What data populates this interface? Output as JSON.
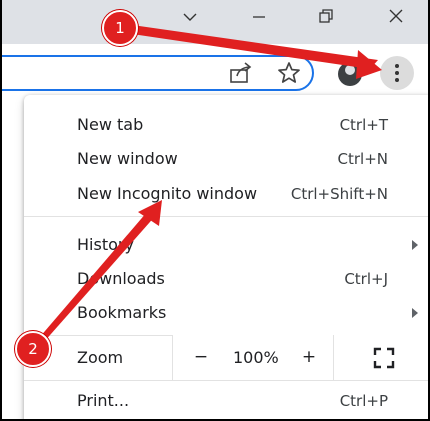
{
  "menu": {
    "items": [
      {
        "label": "New tab",
        "shortcut": "Ctrl+T"
      },
      {
        "label": "New window",
        "shortcut": "Ctrl+N"
      },
      {
        "label": "New Incognito window",
        "shortcut": "Ctrl+Shift+N"
      },
      {
        "label": "History",
        "shortcut": ""
      },
      {
        "label": "Downloads",
        "shortcut": "Ctrl+J"
      },
      {
        "label": "Bookmarks",
        "shortcut": ""
      }
    ],
    "zoom": {
      "label": "Zoom",
      "minus": "−",
      "value": "100%",
      "plus": "+"
    },
    "print": {
      "label": "Print...",
      "shortcut": "Ctrl+P"
    }
  },
  "annotations": {
    "badge_1": "1",
    "badge_2": "2",
    "color": "#e02020"
  },
  "icons": {
    "window": [
      "chevron-down-icon",
      "minimize-icon",
      "restore-icon",
      "close-icon"
    ],
    "toolbar": [
      "share-icon",
      "star-icon",
      "profile-icon",
      "more-vert-icon"
    ]
  },
  "colors": {
    "titlebar": "#dee1e6",
    "omnibox_border": "#1a73e8",
    "menu_bg": "#ffffff",
    "arrow": "#e02020"
  }
}
